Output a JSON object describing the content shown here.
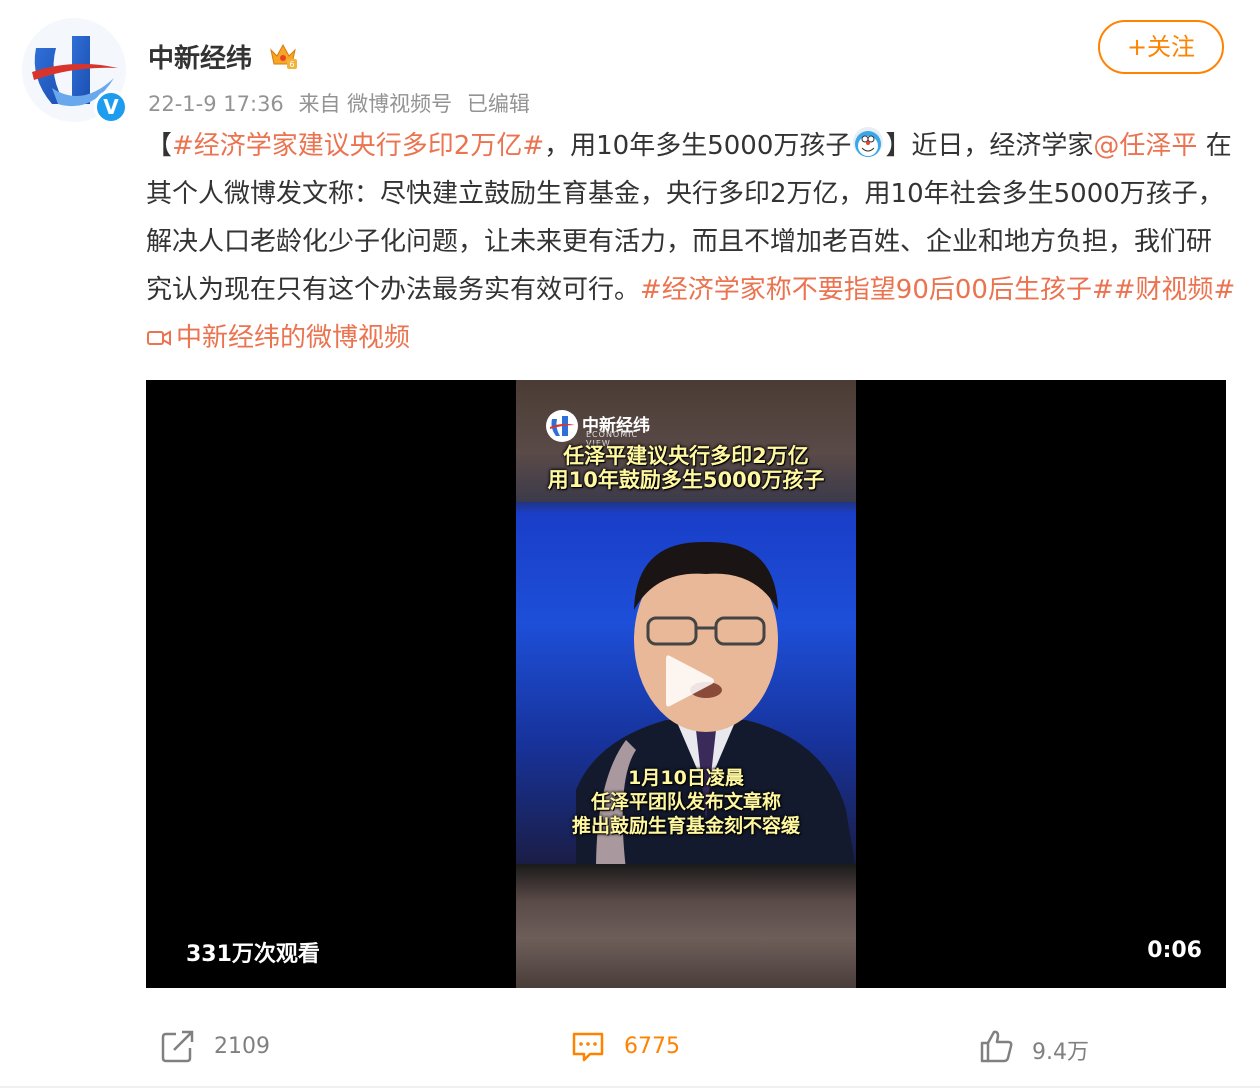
{
  "author": {
    "name": "中新经纬",
    "verified": true,
    "crown_icon": "crown-icon"
  },
  "meta": {
    "time": "22-1-9 17:36",
    "source": "来自 微博视频号",
    "edited": "已编辑"
  },
  "follow_label": "+关注",
  "post": {
    "bracket_open": "【",
    "hashtag1": "#经济学家建议央行多印2万亿#",
    "text1": "，用10年多生5000万孩子",
    "bracket_close": "】近日，经济学家",
    "mention": "@任泽平",
    "text2": " 在其个人微博发文称：尽快建立鼓励生育基金，央行多印2万亿，用10年社会多生5000万孩子，解决人口老龄化少子化问题，让未来更有活力，而且不增加老百姓、企业和地方负担，我们研究认为现在只有这个办法最务实有效可行。",
    "hashtag2": "#经济学家称不要指望90后00后生孩子#",
    "hashtag3": "#财视频#",
    "video_link": "中新经纬的微博视频"
  },
  "video": {
    "logo_text": "中新经纬",
    "logo_sub": "ECONOMIC VIEW",
    "title_line1": "任泽平建议央行多印2万亿",
    "title_line2": "用10年鼓励多生5000万孩子",
    "caption_line1": "1月10日凌晨",
    "caption_line2": "任泽平团队发布文章称",
    "caption_line3": "推出鼓励生育基金刻不容缓",
    "views": "331万次观看",
    "duration": "0:06"
  },
  "actions": {
    "repost": "2109",
    "comment": "6775",
    "like": "9.4万"
  },
  "colors": {
    "accent": "#ff8200",
    "link": "#eb7350",
    "meta": "#939393"
  }
}
